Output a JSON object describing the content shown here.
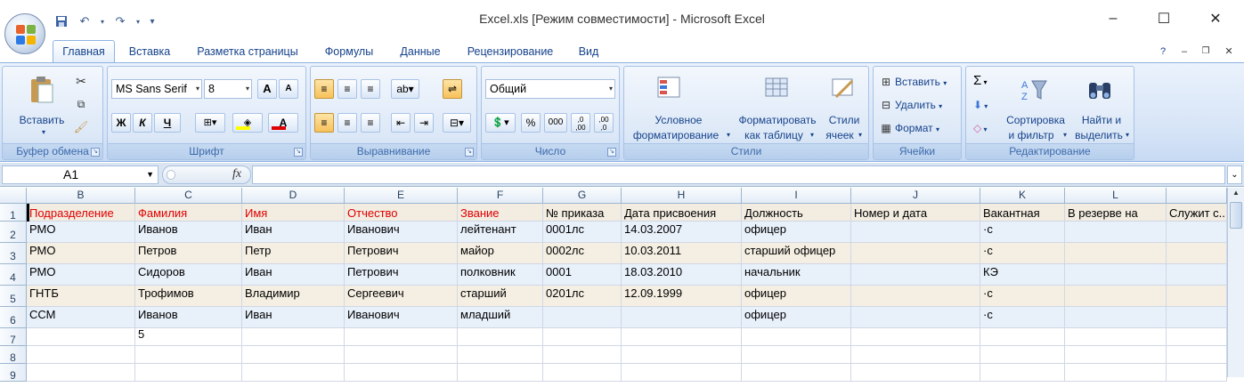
{
  "window": {
    "title": "Excel.xls  [Режим совместимости] - Microsoft Excel",
    "minimize": "–",
    "maximize": "☐",
    "close": "✕"
  },
  "qat": {
    "save_icon": "save-icon",
    "undo_icon": "undo-icon",
    "redo_icon": "redo-icon"
  },
  "tabs": [
    "Главная",
    "Вставка",
    "Разметка страницы",
    "Формулы",
    "Данные",
    "Рецензирование",
    "Вид"
  ],
  "ribbon": {
    "clipboard": {
      "label": "Буфер обмена",
      "paste": "Вставить"
    },
    "font": {
      "label": "Шрифт",
      "name": "MS Sans Serif",
      "size": "8",
      "bold": "Ж",
      "italic": "К",
      "underline": "Ч",
      "grow": "A",
      "shrink": "A",
      "color_letter": "A"
    },
    "alignment": {
      "label": "Выравнивание"
    },
    "number": {
      "label": "Число",
      "format": "Общий",
      "percent": "%",
      "thousands": "000",
      "inc": ",0\n,00",
      "dec": ",00\n,0"
    },
    "styles": {
      "label": "Стили",
      "cond1": "Условное",
      "cond2": "форматирование",
      "fmt1": "Форматировать",
      "fmt2": "как таблицу",
      "cell1": "Стили",
      "cell2": "ячеек"
    },
    "cells": {
      "label": "Ячейки",
      "insert": "Вставить",
      "delete": "Удалить",
      "format": "Формат"
    },
    "editing": {
      "label": "Редактирование",
      "sort1": "Сортировка",
      "sort2": "и фильтр",
      "find1": "Найти и",
      "find2": "выделить",
      "sigma": "Σ"
    }
  },
  "formula_bar": {
    "name_box": "A1",
    "fx": "fx",
    "formula": ""
  },
  "columns": [
    "B",
    "C",
    "D",
    "E",
    "F",
    "G",
    "H",
    "I",
    "J",
    "K",
    "L",
    ""
  ],
  "rows": [
    {
      "num": "1",
      "cells": [
        "Подразделение",
        "Фамилия",
        "Имя",
        "Отчество",
        "Звание",
        "№ приказа",
        "Дата присвоения",
        "Должность",
        "Номер и дата",
        "Вакантная",
        "В резерве на",
        "Служит с..."
      ]
    },
    {
      "num": "2",
      "cells": [
        "РМО",
        "Иванов",
        "Иван",
        "Иванович",
        "лейтенант",
        "0001лс",
        "14.03.2007",
        "офицер",
        "",
        "·с",
        "",
        ""
      ]
    },
    {
      "num": "3",
      "cells": [
        "РМО",
        "Петров",
        "Петр",
        "Петрович",
        "майор",
        "0002лс",
        "10.03.2011",
        "старший офицер",
        "",
        "·с",
        "",
        ""
      ]
    },
    {
      "num": "4",
      "cells": [
        "РМО",
        "Сидоров",
        "Иван",
        "Петрович",
        "полковник",
        "0001",
        "18.03.2010",
        "начальник",
        "",
        "КЭ",
        "",
        ""
      ]
    },
    {
      "num": "5",
      "cells": [
        "ГНТБ",
        "Трофимов",
        "Владимир",
        "Сергеевич",
        "старший",
        "0201лс",
        "12.09.1999",
        "офицер",
        "",
        "·с",
        "",
        ""
      ]
    },
    {
      "num": "6",
      "cells": [
        "ССМ",
        "Иванов",
        "Иван",
        "Иванович",
        "младший",
        "",
        "",
        "офицер",
        "",
        "·с",
        "",
        ""
      ]
    },
    {
      "num": "7",
      "cells": [
        "",
        "5",
        "",
        "",
        "",
        "",
        "",
        "",
        "",
        "",
        "",
        ""
      ]
    },
    {
      "num": "8",
      "cells": [
        "",
        "",
        "",
        "",
        "",
        "",
        "",
        "",
        "",
        "",
        "",
        ""
      ]
    },
    {
      "num": "9",
      "cells": [
        "",
        "",
        "",
        "",
        "",
        "",
        "",
        "",
        "",
        "",
        "",
        ""
      ]
    }
  ],
  "colors": {
    "header_red": "#e00000",
    "band_blue": "#e8f0fa",
    "band_tan": "#f5efe3",
    "row1_bg": "#f2ece1"
  }
}
